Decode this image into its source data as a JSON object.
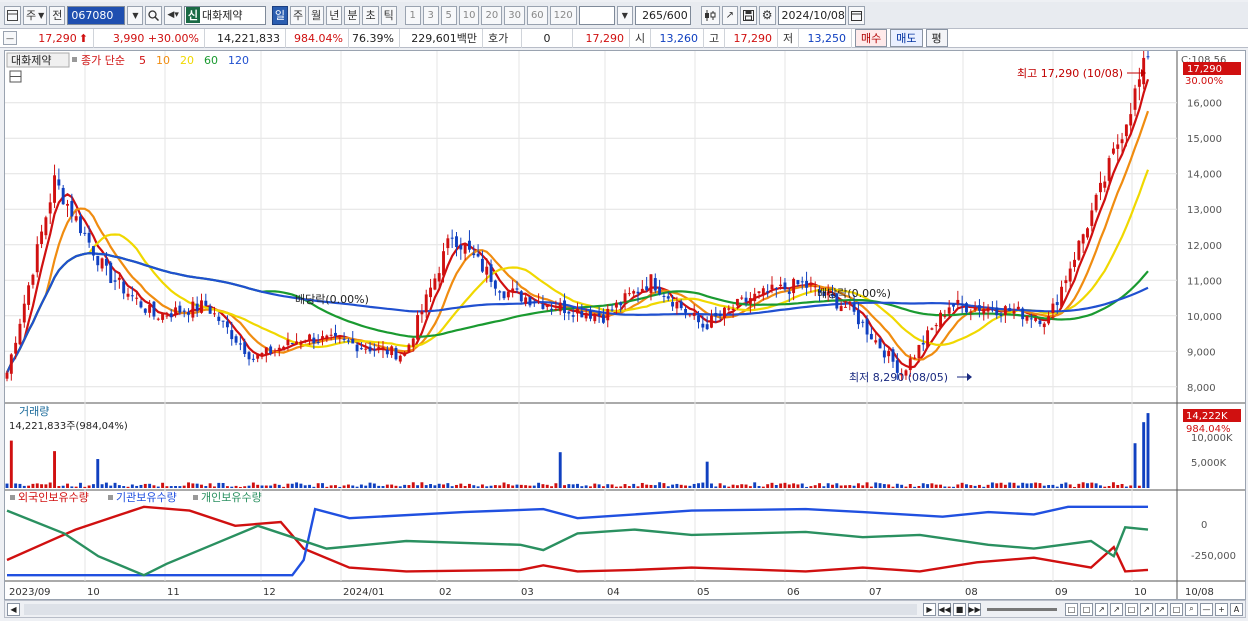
{
  "toolbar": {
    "type_label": "주",
    "prev_label": "전",
    "stock_code": "067080",
    "shin_badge": "신",
    "stock_name": "대화제약",
    "periods": [
      "일",
      "주",
      "월",
      "년",
      "분",
      "초",
      "틱"
    ],
    "active_period": "일",
    "tick_steps": [
      "1",
      "3",
      "5",
      "10",
      "20",
      "30",
      "60",
      "120"
    ],
    "count_value": "265",
    "count_total": "/600",
    "date_value": "2024/10/08"
  },
  "info": {
    "price": "17,290",
    "change": "3,990",
    "change_pct": "+30.00%",
    "volume": "14,221,833",
    "volume_pct": "984.04%",
    "turnover": "76.39%",
    "trade_amount": "229,601백만",
    "hoga_label": "호가",
    "hoga_value": "0",
    "hoga_price": "17,290",
    "open_label": "시",
    "open_value": "13,260",
    "high_label": "고",
    "high_value": "17,290",
    "low_label": "저",
    "low_value": "13,250",
    "buy_label": "매수",
    "sell_label": "매도",
    "eval_label": "평"
  },
  "colors": {
    "up": "#d01010",
    "down": "#1040c0",
    "ma5": "#d01010",
    "ma10": "#f08c10",
    "ma20": "#f0d800",
    "ma60": "#1a9a30",
    "ma120": "#2050d0",
    "foreign": "#d01010",
    "institution": "#2050e0",
    "individual": "#2a9060"
  },
  "chart_data": [
    {
      "type": "candlestick",
      "legend": {
        "stock_name": "대화제약",
        "prefix": "종가 단순",
        "ma_periods": [
          "5",
          "10",
          "20",
          "60",
          "120"
        ]
      },
      "y_ticks": [
        "16,000",
        "15,000",
        "14,000",
        "13,000",
        "12,000",
        "11,000",
        "10,000",
        "9,000",
        "8,000"
      ],
      "ylim": [
        7600,
        17400
      ],
      "top_label": "C:108.56",
      "price_tag": "17,290",
      "price_pct": "30.00%",
      "annotations": {
        "high": "최고 17,290 (10/08)",
        "low": "최저 8,290 (08/05)",
        "dividend_1": "배당락(0.00%)",
        "dividend_2": "배당락(0.00%)"
      },
      "x_labels": [
        "2023/09",
        "10",
        "11",
        "12",
        "2024/01",
        "02",
        "03",
        "04",
        "05",
        "06",
        "07",
        "08",
        "09",
        "10",
        "10/08"
      ],
      "approx_close_path": [
        {
          "x": "2023/09",
          "y": 8400
        },
        {
          "x": "2023/10",
          "y": 13800
        },
        {
          "x": "2023/10/20",
          "y": 11200
        },
        {
          "x": "2023/11",
          "y": 10000
        },
        {
          "x": "2023/11/15",
          "y": 10300
        },
        {
          "x": "2023/12",
          "y": 8800
        },
        {
          "x": "2023/12/20",
          "y": 9400
        },
        {
          "x": "2024/01",
          "y": 9200
        },
        {
          "x": "2024/02",
          "y": 8900
        },
        {
          "x": "2024/03",
          "y": 12300
        },
        {
          "x": "2024/03/15",
          "y": 10700
        },
        {
          "x": "2024/04",
          "y": 10300
        },
        {
          "x": "2024/04/25",
          "y": 10000
        },
        {
          "x": "2024/05",
          "y": 11000
        },
        {
          "x": "2024/06",
          "y": 9700
        },
        {
          "x": "2024/07",
          "y": 10500
        },
        {
          "x": "2024/07/20",
          "y": 10900
        },
        {
          "x": "2024/08",
          "y": 10200
        },
        {
          "x": "2024/08/05",
          "y": 8400
        },
        {
          "x": "2024/08/20",
          "y": 10300
        },
        {
          "x": "2024/09",
          "y": 10200
        },
        {
          "x": "2024/09/20",
          "y": 9900
        },
        {
          "x": "2024/10",
          "y": 13500
        },
        {
          "x": "2024/10/08",
          "y": 17290
        }
      ]
    },
    {
      "type": "bar",
      "title": "거래량",
      "subtitle": "14,221,833주(984,04%)",
      "y_ticks": [
        "10,000K",
        "5,000K"
      ],
      "value_tag": "14,222K",
      "value_pct": "984.04%",
      "spikes_k": [
        {
          "x": "2023/09",
          "value": 9000
        },
        {
          "x": "2023/09/10",
          "value": 7000
        },
        {
          "x": "2023/10",
          "value": 5500
        },
        {
          "x": "2024/03",
          "value": 6800
        },
        {
          "x": "2024/04/25",
          "value": 5000
        },
        {
          "x": "2024/10/02",
          "value": 8500
        },
        {
          "x": "2024/10/07",
          "value": 12500
        },
        {
          "x": "2024/10/08",
          "value": 14222
        }
      ]
    },
    {
      "type": "line",
      "series": [
        {
          "name": "외국인보유수량"
        },
        {
          "name": "기관보유수량"
        },
        {
          "name": "개인보유수량"
        }
      ],
      "y_ticks": [
        "0",
        "-250,000"
      ]
    }
  ]
}
